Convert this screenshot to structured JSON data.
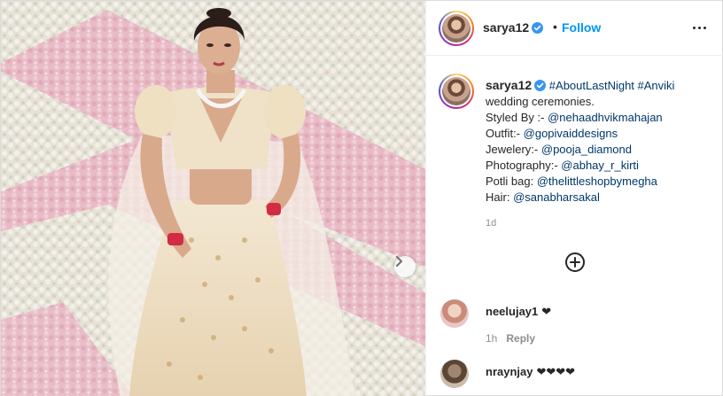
{
  "header": {
    "username": "sarya12",
    "dot": "•",
    "follow_label": "Follow"
  },
  "caption": {
    "username": "sarya12",
    "tags": "#AboutLastNight #Anviki",
    "line1_text": "wedding ceremonies.",
    "styled_label": "Styled By :-",
    "styled_handle": "@nehaadhvikmahajan",
    "outfit_label": "Outfit:-",
    "outfit_handle": "@gopivaiddesigns",
    "jewelery_label": "Jewelery:-",
    "jewelery_handle": "@pooja_diamond",
    "photography_label": "Photography:-",
    "photography_handle": "@abhay_r_kirti",
    "potli_label": "Potli bag:",
    "potli_handle": "@thelittleshopbymegha",
    "hair_label": "Hair:",
    "hair_handle": "@sanabharsakal",
    "timestamp": "1d"
  },
  "comments": [
    {
      "username": "neelujay1",
      "text": "❤",
      "time": "1h",
      "reply_label": "Reply"
    },
    {
      "username": "nraynjay",
      "text": "❤❤❤❤"
    }
  ],
  "icons": {
    "verified": "verified-badge-icon",
    "more": "more-options-icon",
    "add_comment": "plus-circle-icon",
    "next": "chevron-right-icon"
  },
  "colors": {
    "accent": "#0095f6",
    "link": "#00376b",
    "muted": "#8e8e8e"
  }
}
